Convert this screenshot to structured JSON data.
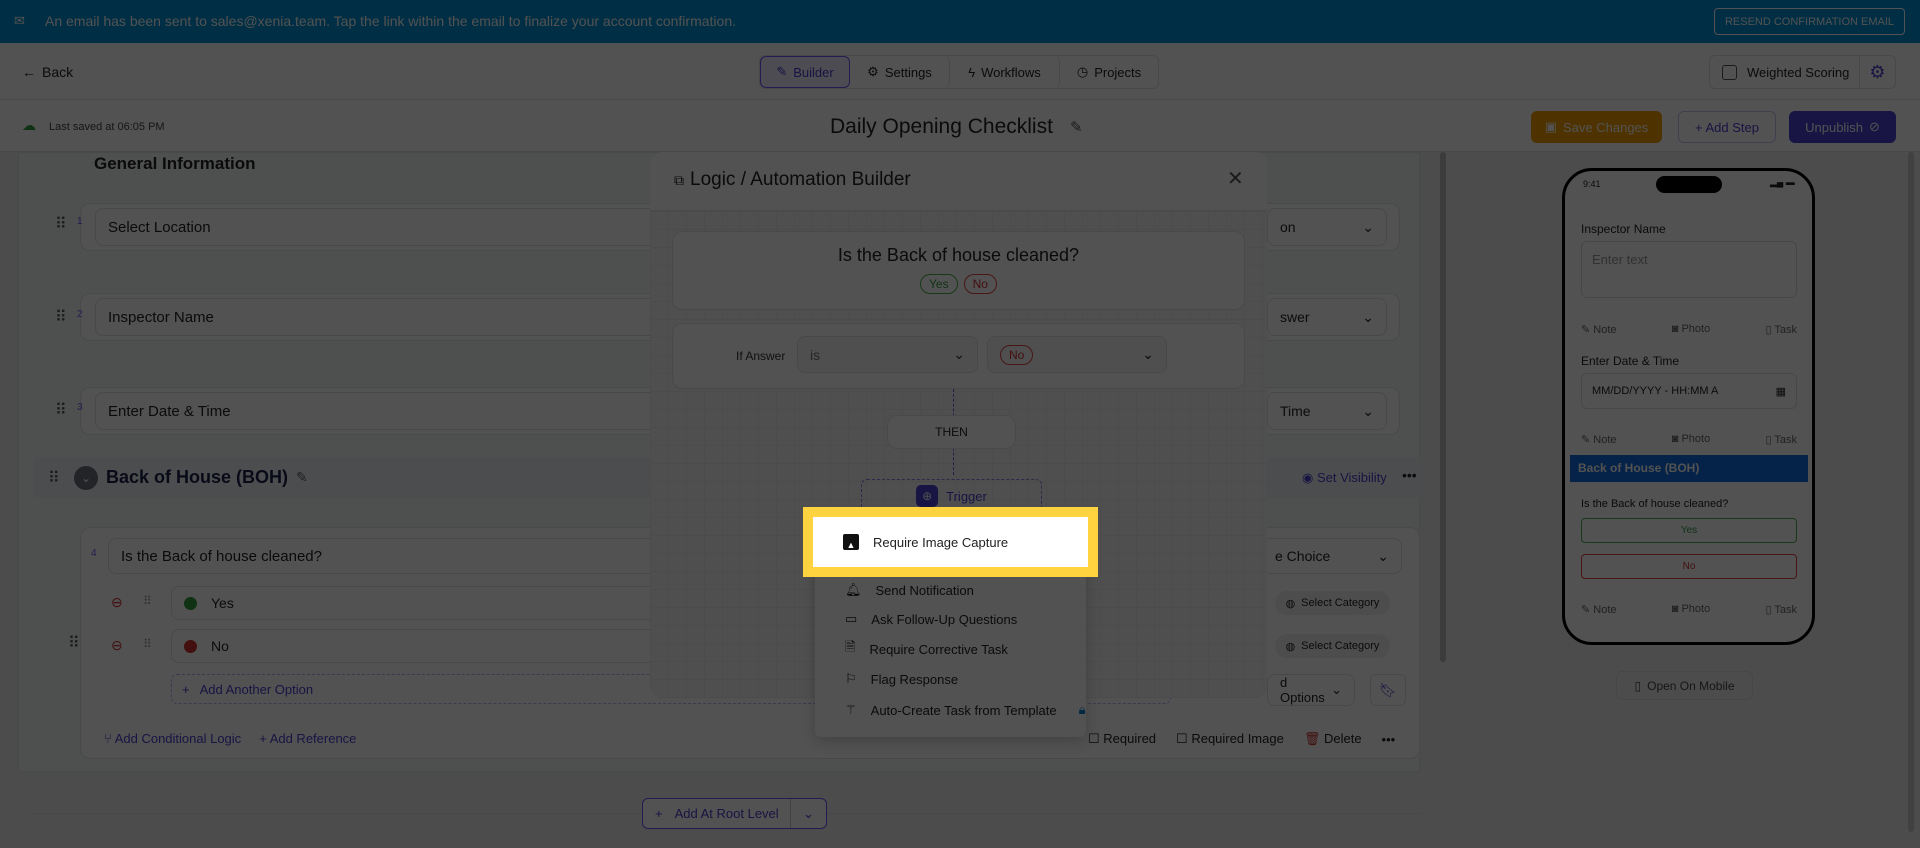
{
  "banner": {
    "text": "An email has been sent to sales@xenia.team. Tap the link within the email to finalize your account confirmation.",
    "button": "RESEND CONFIRMATION EMAIL"
  },
  "nav": {
    "back": "Back",
    "tabs": [
      "Builder",
      "Settings",
      "Workflows",
      "Projects"
    ],
    "weighted_scoring": "Weighted Scoring"
  },
  "toolbar": {
    "last_saved": "Last saved at 06:05 PM",
    "title": "Daily Opening Checklist",
    "save": "Save Changes",
    "add_step": "+ Add Step",
    "unpublish": "Unpublish"
  },
  "builder": {
    "section1": "General Information",
    "questions": [
      {
        "n": "1",
        "label": "Select Location",
        "type": "on"
      },
      {
        "n": "2",
        "label": "Inspector Name",
        "type": "swer"
      },
      {
        "n": "3",
        "label": "Enter Date & Time",
        "type": "Time"
      }
    ],
    "section2": "Back of House (BOH)",
    "set_visibility": "Set Visibility",
    "q4": {
      "n": "4",
      "label": "Is the Back of house cleaned?",
      "type": "e Choice",
      "options": [
        "Yes",
        "No"
      ],
      "select_category": "Select Category",
      "add_option": "Add Another Option",
      "more_options": "d Options",
      "conditional": "Add Conditional Logic",
      "reference": "Add Reference",
      "required": "Required",
      "required_image": "Required Image",
      "delete": "Delete"
    },
    "add_root": "Add At Root Level"
  },
  "modal": {
    "title": "Logic / Automation Builder",
    "question": "Is the Back of house cleaned?",
    "chips": [
      "Yes",
      "No"
    ],
    "if_answer": "If Answer",
    "operator": "is",
    "value": "No",
    "then": "THEN",
    "trigger": "Trigger"
  },
  "menu": {
    "items": [
      "Require Image Capture",
      "Send Notification",
      "Ask Follow-Up Questions",
      "Require Corrective Task",
      "Flag Response",
      "Auto-Create Task from Template"
    ]
  },
  "preview": {
    "time": "9:41",
    "top_actions": [
      "Note",
      "Photo",
      "Task"
    ],
    "inspector": "Inspector Name",
    "placeholder": "Enter text",
    "date_label": "Enter Date & Time",
    "date_placeholder": "MM/DD/YYYY - HH:MM A",
    "section": "Back of House (BOH)",
    "question": "Is the Back of house cleaned?",
    "yes": "Yes",
    "no": "No",
    "open_mobile": "Open On Mobile"
  },
  "colors": {
    "accent": "#4b3fd1",
    "banner": "#0091d4",
    "save": "#f5a000",
    "highlight": "#ffd23f"
  }
}
